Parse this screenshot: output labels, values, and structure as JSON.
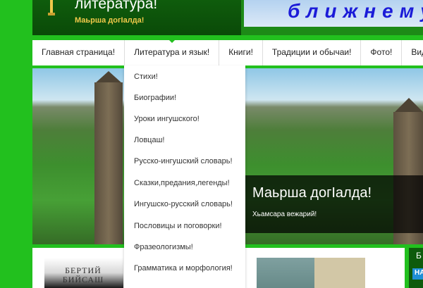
{
  "header": {
    "title": "литература!",
    "subtitle": "Маьрша догIалда!",
    "banner_text": "ближнему"
  },
  "nav": {
    "items": [
      {
        "label": "Главная страница!"
      },
      {
        "label": "Литература и язык!"
      },
      {
        "label": "Книги!"
      },
      {
        "label": "Традиции и обычаи!"
      },
      {
        "label": "Фото!"
      },
      {
        "label": "Видео"
      }
    ]
  },
  "dropdown": {
    "items": [
      {
        "label": "Стихи!"
      },
      {
        "label": "Биографии!"
      },
      {
        "label": "Уроки ингушского!"
      },
      {
        "label": "Ловцаш!"
      },
      {
        "label": "Русско-ингушский словарь!"
      },
      {
        "label": "Сказки,предания,легенды!"
      },
      {
        "label": "Ингушско-русский словарь!"
      },
      {
        "label": "Пословицы и поговорки!"
      },
      {
        "label": "Фразеологизмы!"
      },
      {
        "label": "Грамматика и морфология!"
      }
    ]
  },
  "slider": {
    "caption_title": "Маьрша догIалда!",
    "caption_subtitle": "Хьамсара вежарий!"
  },
  "content": {
    "book1_title": "БЕРТИЙ БИЙСАШ"
  },
  "sidebar": {
    "label": "Б",
    "chip_label": "НА"
  },
  "colors": {
    "page_bg": "#22c01e",
    "header_bg": "#0f5c0c",
    "subtitle": "#f0c94a",
    "banner_text": "#1b1bd8"
  }
}
